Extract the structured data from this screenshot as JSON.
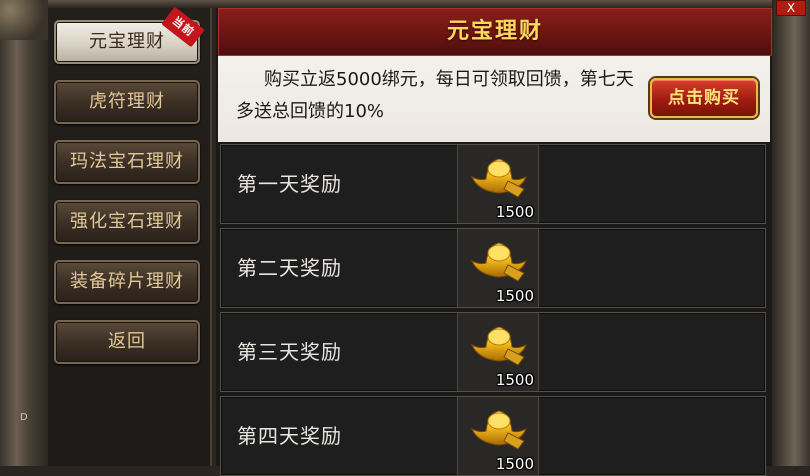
{
  "window": {
    "close_label": "X",
    "edge_mark": "D"
  },
  "menu": {
    "items": [
      {
        "label": "元宝理财",
        "active": true,
        "badge": "当前"
      },
      {
        "label": "虎符理财"
      },
      {
        "label": "玛法宝石理财"
      },
      {
        "label": "强化宝石理财"
      },
      {
        "label": "装备碎片理财"
      },
      {
        "label": "返回"
      }
    ]
  },
  "panel": {
    "title": "元宝理财",
    "description": "购买立返5000绑元，每日可领取回馈，第七天多送总回馈的10%",
    "buy_label": "点击购买"
  },
  "rewards": [
    {
      "label": "第一天奖励",
      "item_icon": "gold-ingot-icon",
      "quantity": "1500"
    },
    {
      "label": "第二天奖励",
      "item_icon": "gold-ingot-icon",
      "quantity": "1500"
    },
    {
      "label": "第三天奖励",
      "item_icon": "gold-ingot-icon",
      "quantity": "1500"
    },
    {
      "label": "第四天奖励",
      "item_icon": "gold-ingot-icon",
      "quantity": "1500"
    }
  ],
  "colors": {
    "title_text": "#ffd95c",
    "title_bar": "#6b1512",
    "menu_text": "#e3c898",
    "close_button": "#b01d10"
  }
}
